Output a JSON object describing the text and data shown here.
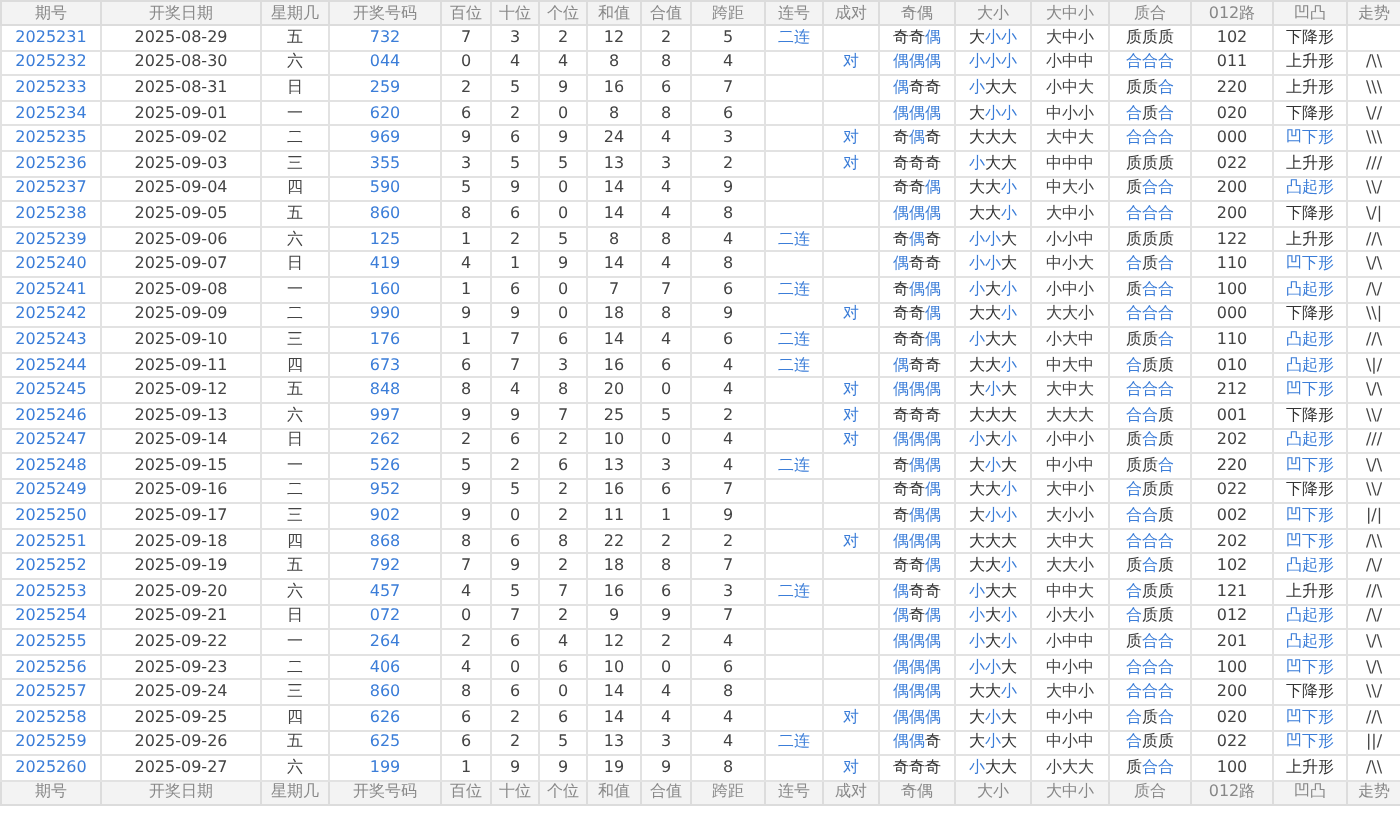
{
  "columns": [
    "期号",
    "开奖日期",
    "星期几",
    "开奖号码",
    "百位",
    "十位",
    "个位",
    "和值",
    "合值",
    "跨距",
    "连号",
    "成对",
    "奇偶",
    "大小",
    "大中小",
    "质合",
    "012路",
    "凹凸",
    "走势"
  ],
  "rows": [
    {
      "period": "2025231",
      "date": "2025-08-29",
      "weekday": "五",
      "number": "732",
      "hundreds": "7",
      "tens": "3",
      "units": "2",
      "sum": "12",
      "sum_tail": "2",
      "span": "5",
      "consecutive": "二连",
      "odd_even": {
        "text": "奇奇偶",
        "highlight": [
          false,
          false,
          true
        ]
      },
      "big_small": {
        "text": "大小小",
        "highlight": [
          false,
          true,
          true
        ]
      },
      "big_mid_small": "大中小",
      "prime_composite": {
        "text": "质质质",
        "highlight": [
          false,
          false,
          false
        ]
      },
      "route_012": "102",
      "shape": {
        "text": "下降形",
        "highlight": false
      }
    },
    {
      "period": "2025232",
      "date": "2025-08-30",
      "weekday": "六",
      "number": "044",
      "hundreds": "0",
      "tens": "4",
      "units": "4",
      "sum": "8",
      "sum_tail": "8",
      "span": "4",
      "pair": "对",
      "odd_even": {
        "text": "偶偶偶",
        "highlight": [
          true,
          true,
          true
        ]
      },
      "big_small": {
        "text": "小小小",
        "highlight": [
          true,
          true,
          true
        ]
      },
      "big_mid_small": "小中中",
      "prime_composite": {
        "text": "合合合",
        "highlight": [
          true,
          true,
          true
        ]
      },
      "route_012": "011",
      "shape": {
        "text": "上升形",
        "highlight": false
      },
      "trend": "/\\\\"
    },
    {
      "period": "2025233",
      "date": "2025-08-31",
      "weekday": "日",
      "number": "259",
      "hundreds": "2",
      "tens": "5",
      "units": "9",
      "sum": "16",
      "sum_tail": "6",
      "span": "7",
      "odd_even": {
        "text": "偶奇奇",
        "highlight": [
          true,
          false,
          false
        ]
      },
      "big_small": {
        "text": "小大大",
        "highlight": [
          true,
          false,
          false
        ]
      },
      "big_mid_small": "小中大",
      "prime_composite": {
        "text": "质质合",
        "highlight": [
          false,
          false,
          true
        ]
      },
      "route_012": "220",
      "shape": {
        "text": "上升形",
        "highlight": false
      },
      "trend": "\\\\\\"
    },
    {
      "period": "2025234",
      "date": "2025-09-01",
      "weekday": "一",
      "number": "620",
      "hundreds": "6",
      "tens": "2",
      "units": "0",
      "sum": "8",
      "sum_tail": "8",
      "span": "6",
      "odd_even": {
        "text": "偶偶偶",
        "highlight": [
          true,
          true,
          true
        ]
      },
      "big_small": {
        "text": "大小小",
        "highlight": [
          false,
          true,
          true
        ]
      },
      "big_mid_small": "中小小",
      "prime_composite": {
        "text": "合质合",
        "highlight": [
          true,
          false,
          true
        ]
      },
      "route_012": "020",
      "shape": {
        "text": "下降形",
        "highlight": false
      },
      "trend": "\\//"
    },
    {
      "period": "2025235",
      "date": "2025-09-02",
      "weekday": "二",
      "number": "969",
      "hundreds": "9",
      "tens": "6",
      "units": "9",
      "sum": "24",
      "sum_tail": "4",
      "span": "3",
      "pair": "对",
      "odd_even": {
        "text": "奇偶奇",
        "highlight": [
          false,
          true,
          false
        ]
      },
      "big_small": {
        "text": "大大大",
        "highlight": [
          false,
          false,
          false
        ]
      },
      "big_mid_small": "大中大",
      "prime_composite": {
        "text": "合合合",
        "highlight": [
          true,
          true,
          true
        ]
      },
      "route_012": "000",
      "shape": {
        "text": "凹下形",
        "highlight": true
      },
      "trend": "\\\\\\"
    },
    {
      "period": "2025236",
      "date": "2025-09-03",
      "weekday": "三",
      "number": "355",
      "hundreds": "3",
      "tens": "5",
      "units": "5",
      "sum": "13",
      "sum_tail": "3",
      "span": "2",
      "pair": "对",
      "odd_even": {
        "text": "奇奇奇",
        "highlight": [
          false,
          false,
          false
        ]
      },
      "big_small": {
        "text": "小大大",
        "highlight": [
          true,
          false,
          false
        ]
      },
      "big_mid_small": "中中中",
      "prime_composite": {
        "text": "质质质",
        "highlight": [
          false,
          false,
          false
        ]
      },
      "route_012": "022",
      "shape": {
        "text": "上升形",
        "highlight": false
      },
      "trend": "///"
    },
    {
      "period": "2025237",
      "date": "2025-09-04",
      "weekday": "四",
      "number": "590",
      "hundreds": "5",
      "tens": "9",
      "units": "0",
      "sum": "14",
      "sum_tail": "4",
      "span": "9",
      "odd_even": {
        "text": "奇奇偶",
        "highlight": [
          false,
          false,
          true
        ]
      },
      "big_small": {
        "text": "大大小",
        "highlight": [
          false,
          false,
          true
        ]
      },
      "big_mid_small": "中大小",
      "prime_composite": {
        "text": "质合合",
        "highlight": [
          false,
          true,
          true
        ]
      },
      "route_012": "200",
      "shape": {
        "text": "凸起形",
        "highlight": true
      },
      "trend": "\\\\/"
    },
    {
      "period": "2025238",
      "date": "2025-09-05",
      "weekday": "五",
      "number": "860",
      "hundreds": "8",
      "tens": "6",
      "units": "0",
      "sum": "14",
      "sum_tail": "4",
      "span": "8",
      "odd_even": {
        "text": "偶偶偶",
        "highlight": [
          true,
          true,
          true
        ]
      },
      "big_small": {
        "text": "大大小",
        "highlight": [
          false,
          false,
          true
        ]
      },
      "big_mid_small": "大中小",
      "prime_composite": {
        "text": "合合合",
        "highlight": [
          true,
          true,
          true
        ]
      },
      "route_012": "200",
      "shape": {
        "text": "下降形",
        "highlight": false
      },
      "trend": "\\/|"
    },
    {
      "period": "2025239",
      "date": "2025-09-06",
      "weekday": "六",
      "number": "125",
      "hundreds": "1",
      "tens": "2",
      "units": "5",
      "sum": "8",
      "sum_tail": "8",
      "span": "4",
      "consecutive": "二连",
      "odd_even": {
        "text": "奇偶奇",
        "highlight": [
          false,
          true,
          false
        ]
      },
      "big_small": {
        "text": "小小大",
        "highlight": [
          true,
          true,
          false
        ]
      },
      "big_mid_small": "小小中",
      "prime_composite": {
        "text": "质质质",
        "highlight": [
          false,
          false,
          false
        ]
      },
      "route_012": "122",
      "shape": {
        "text": "上升形",
        "highlight": false
      },
      "trend": "//\\"
    },
    {
      "period": "2025240",
      "date": "2025-09-07",
      "weekday": "日",
      "number": "419",
      "hundreds": "4",
      "tens": "1",
      "units": "9",
      "sum": "14",
      "sum_tail": "4",
      "span": "8",
      "odd_even": {
        "text": "偶奇奇",
        "highlight": [
          true,
          false,
          false
        ]
      },
      "big_small": {
        "text": "小小大",
        "highlight": [
          true,
          true,
          false
        ]
      },
      "big_mid_small": "中小大",
      "prime_composite": {
        "text": "合质合",
        "highlight": [
          true,
          false,
          true
        ]
      },
      "route_012": "110",
      "shape": {
        "text": "凹下形",
        "highlight": true
      },
      "trend": "\\/\\"
    },
    {
      "period": "2025241",
      "date": "2025-09-08",
      "weekday": "一",
      "number": "160",
      "hundreds": "1",
      "tens": "6",
      "units": "0",
      "sum": "7",
      "sum_tail": "7",
      "span": "6",
      "consecutive": "二连",
      "odd_even": {
        "text": "奇偶偶",
        "highlight": [
          false,
          true,
          true
        ]
      },
      "big_small": {
        "text": "小大小",
        "highlight": [
          true,
          false,
          true
        ]
      },
      "big_mid_small": "小中小",
      "prime_composite": {
        "text": "质合合",
        "highlight": [
          false,
          true,
          true
        ]
      },
      "route_012": "100",
      "shape": {
        "text": "凸起形",
        "highlight": true
      },
      "trend": "/\\/"
    },
    {
      "period": "2025242",
      "date": "2025-09-09",
      "weekday": "二",
      "number": "990",
      "hundreds": "9",
      "tens": "9",
      "units": "0",
      "sum": "18",
      "sum_tail": "8",
      "span": "9",
      "pair": "对",
      "odd_even": {
        "text": "奇奇偶",
        "highlight": [
          false,
          false,
          true
        ]
      },
      "big_small": {
        "text": "大大小",
        "highlight": [
          false,
          false,
          true
        ]
      },
      "big_mid_small": "大大小",
      "prime_composite": {
        "text": "合合合",
        "highlight": [
          true,
          true,
          true
        ]
      },
      "route_012": "000",
      "shape": {
        "text": "下降形",
        "highlight": false
      },
      "trend": "\\\\|"
    },
    {
      "period": "2025243",
      "date": "2025-09-10",
      "weekday": "三",
      "number": "176",
      "hundreds": "1",
      "tens": "7",
      "units": "6",
      "sum": "14",
      "sum_tail": "4",
      "span": "6",
      "consecutive": "二连",
      "odd_even": {
        "text": "奇奇偶",
        "highlight": [
          false,
          false,
          true
        ]
      },
      "big_small": {
        "text": "小大大",
        "highlight": [
          true,
          false,
          false
        ]
      },
      "big_mid_small": "小大中",
      "prime_composite": {
        "text": "质质合",
        "highlight": [
          false,
          false,
          true
        ]
      },
      "route_012": "110",
      "shape": {
        "text": "凸起形",
        "highlight": true
      },
      "trend": "//\\"
    },
    {
      "period": "2025244",
      "date": "2025-09-11",
      "weekday": "四",
      "number": "673",
      "hundreds": "6",
      "tens": "7",
      "units": "3",
      "sum": "16",
      "sum_tail": "6",
      "span": "4",
      "consecutive": "二连",
      "odd_even": {
        "text": "偶奇奇",
        "highlight": [
          true,
          false,
          false
        ]
      },
      "big_small": {
        "text": "大大小",
        "highlight": [
          false,
          false,
          true
        ]
      },
      "big_mid_small": "中大中",
      "prime_composite": {
        "text": "合质质",
        "highlight": [
          true,
          false,
          false
        ]
      },
      "route_012": "010",
      "shape": {
        "text": "凸起形",
        "highlight": true
      },
      "trend": "\\|/"
    },
    {
      "period": "2025245",
      "date": "2025-09-12",
      "weekday": "五",
      "number": "848",
      "hundreds": "8",
      "tens": "4",
      "units": "8",
      "sum": "20",
      "sum_tail": "0",
      "span": "4",
      "pair": "对",
      "odd_even": {
        "text": "偶偶偶",
        "highlight": [
          true,
          true,
          true
        ]
      },
      "big_small": {
        "text": "大小大",
        "highlight": [
          false,
          true,
          false
        ]
      },
      "big_mid_small": "大中大",
      "prime_composite": {
        "text": "合合合",
        "highlight": [
          true,
          true,
          true
        ]
      },
      "route_012": "212",
      "shape": {
        "text": "凹下形",
        "highlight": true
      },
      "trend": "\\/\\"
    },
    {
      "period": "2025246",
      "date": "2025-09-13",
      "weekday": "六",
      "number": "997",
      "hundreds": "9",
      "tens": "9",
      "units": "7",
      "sum": "25",
      "sum_tail": "5",
      "span": "2",
      "pair": "对",
      "odd_even": {
        "text": "奇奇奇",
        "highlight": [
          false,
          false,
          false
        ]
      },
      "big_small": {
        "text": "大大大",
        "highlight": [
          false,
          false,
          false
        ]
      },
      "big_mid_small": "大大大",
      "prime_composite": {
        "text": "合合质",
        "highlight": [
          true,
          true,
          false
        ]
      },
      "route_012": "001",
      "shape": {
        "text": "下降形",
        "highlight": false
      },
      "trend": "\\\\/"
    },
    {
      "period": "2025247",
      "date": "2025-09-14",
      "weekday": "日",
      "number": "262",
      "hundreds": "2",
      "tens": "6",
      "units": "2",
      "sum": "10",
      "sum_tail": "0",
      "span": "4",
      "pair": "对",
      "odd_even": {
        "text": "偶偶偶",
        "highlight": [
          true,
          true,
          true
        ]
      },
      "big_small": {
        "text": "小大小",
        "highlight": [
          true,
          false,
          true
        ]
      },
      "big_mid_small": "小中小",
      "prime_composite": {
        "text": "质合质",
        "highlight": [
          false,
          true,
          false
        ]
      },
      "route_012": "202",
      "shape": {
        "text": "凸起形",
        "highlight": true
      },
      "trend": "///"
    },
    {
      "period": "2025248",
      "date": "2025-09-15",
      "weekday": "一",
      "number": "526",
      "hundreds": "5",
      "tens": "2",
      "units": "6",
      "sum": "13",
      "sum_tail": "3",
      "span": "4",
      "consecutive": "二连",
      "odd_even": {
        "text": "奇偶偶",
        "highlight": [
          false,
          true,
          true
        ]
      },
      "big_small": {
        "text": "大小大",
        "highlight": [
          false,
          true,
          false
        ]
      },
      "big_mid_small": "中小中",
      "prime_composite": {
        "text": "质质合",
        "highlight": [
          false,
          false,
          true
        ]
      },
      "route_012": "220",
      "shape": {
        "text": "凹下形",
        "highlight": true
      },
      "trend": "\\/\\"
    },
    {
      "period": "2025249",
      "date": "2025-09-16",
      "weekday": "二",
      "number": "952",
      "hundreds": "9",
      "tens": "5",
      "units": "2",
      "sum": "16",
      "sum_tail": "6",
      "span": "7",
      "odd_even": {
        "text": "奇奇偶",
        "highlight": [
          false,
          false,
          true
        ]
      },
      "big_small": {
        "text": "大大小",
        "highlight": [
          false,
          false,
          true
        ]
      },
      "big_mid_small": "大中小",
      "prime_composite": {
        "text": "合质质",
        "highlight": [
          true,
          false,
          false
        ]
      },
      "route_012": "022",
      "shape": {
        "text": "下降形",
        "highlight": false
      },
      "trend": "\\\\/"
    },
    {
      "period": "2025250",
      "date": "2025-09-17",
      "weekday": "三",
      "number": "902",
      "hundreds": "9",
      "tens": "0",
      "units": "2",
      "sum": "11",
      "sum_tail": "1",
      "span": "9",
      "odd_even": {
        "text": "奇偶偶",
        "highlight": [
          false,
          true,
          true
        ]
      },
      "big_small": {
        "text": "大小小",
        "highlight": [
          false,
          true,
          true
        ]
      },
      "big_mid_small": "大小小",
      "prime_composite": {
        "text": "合合质",
        "highlight": [
          true,
          true,
          false
        ]
      },
      "route_012": "002",
      "shape": {
        "text": "凹下形",
        "highlight": true
      },
      "trend": "|/|"
    },
    {
      "period": "2025251",
      "date": "2025-09-18",
      "weekday": "四",
      "number": "868",
      "hundreds": "8",
      "tens": "6",
      "units": "8",
      "sum": "22",
      "sum_tail": "2",
      "span": "2",
      "pair": "对",
      "odd_even": {
        "text": "偶偶偶",
        "highlight": [
          true,
          true,
          true
        ]
      },
      "big_small": {
        "text": "大大大",
        "highlight": [
          false,
          false,
          false
        ]
      },
      "big_mid_small": "大中大",
      "prime_composite": {
        "text": "合合合",
        "highlight": [
          true,
          true,
          true
        ]
      },
      "route_012": "202",
      "shape": {
        "text": "凹下形",
        "highlight": true
      },
      "trend": "/\\\\"
    },
    {
      "period": "2025252",
      "date": "2025-09-19",
      "weekday": "五",
      "number": "792",
      "hundreds": "7",
      "tens": "9",
      "units": "2",
      "sum": "18",
      "sum_tail": "8",
      "span": "7",
      "odd_even": {
        "text": "奇奇偶",
        "highlight": [
          false,
          false,
          true
        ]
      },
      "big_small": {
        "text": "大大小",
        "highlight": [
          false,
          false,
          true
        ]
      },
      "big_mid_small": "大大小",
      "prime_composite": {
        "text": "质合质",
        "highlight": [
          false,
          true,
          false
        ]
      },
      "route_012": "102",
      "shape": {
        "text": "凸起形",
        "highlight": true
      },
      "trend": "/\\/"
    },
    {
      "period": "2025253",
      "date": "2025-09-20",
      "weekday": "六",
      "number": "457",
      "hundreds": "4",
      "tens": "5",
      "units": "7",
      "sum": "16",
      "sum_tail": "6",
      "span": "3",
      "consecutive": "二连",
      "odd_even": {
        "text": "偶奇奇",
        "highlight": [
          true,
          false,
          false
        ]
      },
      "big_small": {
        "text": "小大大",
        "highlight": [
          true,
          false,
          false
        ]
      },
      "big_mid_small": "中中大",
      "prime_composite": {
        "text": "合质质",
        "highlight": [
          true,
          false,
          false
        ]
      },
      "route_012": "121",
      "shape": {
        "text": "上升形",
        "highlight": false
      },
      "trend": "//\\"
    },
    {
      "period": "2025254",
      "date": "2025-09-21",
      "weekday": "日",
      "number": "072",
      "hundreds": "0",
      "tens": "7",
      "units": "2",
      "sum": "9",
      "sum_tail": "9",
      "span": "7",
      "odd_even": {
        "text": "偶奇偶",
        "highlight": [
          true,
          false,
          true
        ]
      },
      "big_small": {
        "text": "小大小",
        "highlight": [
          true,
          false,
          true
        ]
      },
      "big_mid_small": "小大小",
      "prime_composite": {
        "text": "合质质",
        "highlight": [
          true,
          false,
          false
        ]
      },
      "route_012": "012",
      "shape": {
        "text": "凸起形",
        "highlight": true
      },
      "trend": "/\\/"
    },
    {
      "period": "2025255",
      "date": "2025-09-22",
      "weekday": "一",
      "number": "264",
      "hundreds": "2",
      "tens": "6",
      "units": "4",
      "sum": "12",
      "sum_tail": "2",
      "span": "4",
      "odd_even": {
        "text": "偶偶偶",
        "highlight": [
          true,
          true,
          true
        ]
      },
      "big_small": {
        "text": "小大小",
        "highlight": [
          true,
          false,
          true
        ]
      },
      "big_mid_small": "小中中",
      "prime_composite": {
        "text": "质合合",
        "highlight": [
          false,
          true,
          true
        ]
      },
      "route_012": "201",
      "shape": {
        "text": "凸起形",
        "highlight": true
      },
      "trend": "\\/\\"
    },
    {
      "period": "2025256",
      "date": "2025-09-23",
      "weekday": "二",
      "number": "406",
      "hundreds": "4",
      "tens": "0",
      "units": "6",
      "sum": "10",
      "sum_tail": "0",
      "span": "6",
      "odd_even": {
        "text": "偶偶偶",
        "highlight": [
          true,
          true,
          true
        ]
      },
      "big_small": {
        "text": "小小大",
        "highlight": [
          true,
          true,
          false
        ]
      },
      "big_mid_small": "中小中",
      "prime_composite": {
        "text": "合合合",
        "highlight": [
          true,
          true,
          true
        ]
      },
      "route_012": "100",
      "shape": {
        "text": "凹下形",
        "highlight": true
      },
      "trend": "\\/\\"
    },
    {
      "period": "2025257",
      "date": "2025-09-24",
      "weekday": "三",
      "number": "860",
      "hundreds": "8",
      "tens": "6",
      "units": "0",
      "sum": "14",
      "sum_tail": "4",
      "span": "8",
      "odd_even": {
        "text": "偶偶偶",
        "highlight": [
          true,
          true,
          true
        ]
      },
      "big_small": {
        "text": "大大小",
        "highlight": [
          false,
          false,
          true
        ]
      },
      "big_mid_small": "大中小",
      "prime_composite": {
        "text": "合合合",
        "highlight": [
          true,
          true,
          true
        ]
      },
      "route_012": "200",
      "shape": {
        "text": "下降形",
        "highlight": false
      },
      "trend": "\\\\/"
    },
    {
      "period": "2025258",
      "date": "2025-09-25",
      "weekday": "四",
      "number": "626",
      "hundreds": "6",
      "tens": "2",
      "units": "6",
      "sum": "14",
      "sum_tail": "4",
      "span": "4",
      "pair": "对",
      "odd_even": {
        "text": "偶偶偶",
        "highlight": [
          true,
          true,
          true
        ]
      },
      "big_small": {
        "text": "大小大",
        "highlight": [
          false,
          true,
          false
        ]
      },
      "big_mid_small": "中小中",
      "prime_composite": {
        "text": "合质合",
        "highlight": [
          true,
          false,
          true
        ]
      },
      "route_012": "020",
      "shape": {
        "text": "凹下形",
        "highlight": true
      },
      "trend": "//\\"
    },
    {
      "period": "2025259",
      "date": "2025-09-26",
      "weekday": "五",
      "number": "625",
      "hundreds": "6",
      "tens": "2",
      "units": "5",
      "sum": "13",
      "sum_tail": "3",
      "span": "4",
      "consecutive": "二连",
      "odd_even": {
        "text": "偶偶奇",
        "highlight": [
          true,
          true,
          false
        ]
      },
      "big_small": {
        "text": "大小大",
        "highlight": [
          false,
          true,
          false
        ]
      },
      "big_mid_small": "中小中",
      "prime_composite": {
        "text": "合质质",
        "highlight": [
          true,
          false,
          false
        ]
      },
      "route_012": "022",
      "shape": {
        "text": "凹下形",
        "highlight": true
      },
      "trend": "||/"
    },
    {
      "period": "2025260",
      "date": "2025-09-27",
      "weekday": "六",
      "number": "199",
      "hundreds": "1",
      "tens": "9",
      "units": "9",
      "sum": "19",
      "sum_tail": "9",
      "span": "8",
      "pair": "对",
      "odd_even": {
        "text": "奇奇奇",
        "highlight": [
          false,
          false,
          false
        ]
      },
      "big_small": {
        "text": "小大大",
        "highlight": [
          true,
          false,
          false
        ]
      },
      "big_mid_small": "小大大",
      "prime_composite": {
        "text": "质合合",
        "highlight": [
          false,
          true,
          true
        ]
      },
      "route_012": "100",
      "shape": {
        "text": "上升形",
        "highlight": false
      },
      "trend": "/\\\\"
    }
  ],
  "footer_columns": [
    "期号",
    "开奖日期",
    "星期几",
    "开奖号码",
    "百位",
    "十位",
    "个位",
    "和值",
    "合值",
    "跨距",
    "连号",
    "成对",
    "奇偶",
    "大小",
    "大中小",
    "质合",
    "012路",
    "凹凸",
    "走势"
  ]
}
